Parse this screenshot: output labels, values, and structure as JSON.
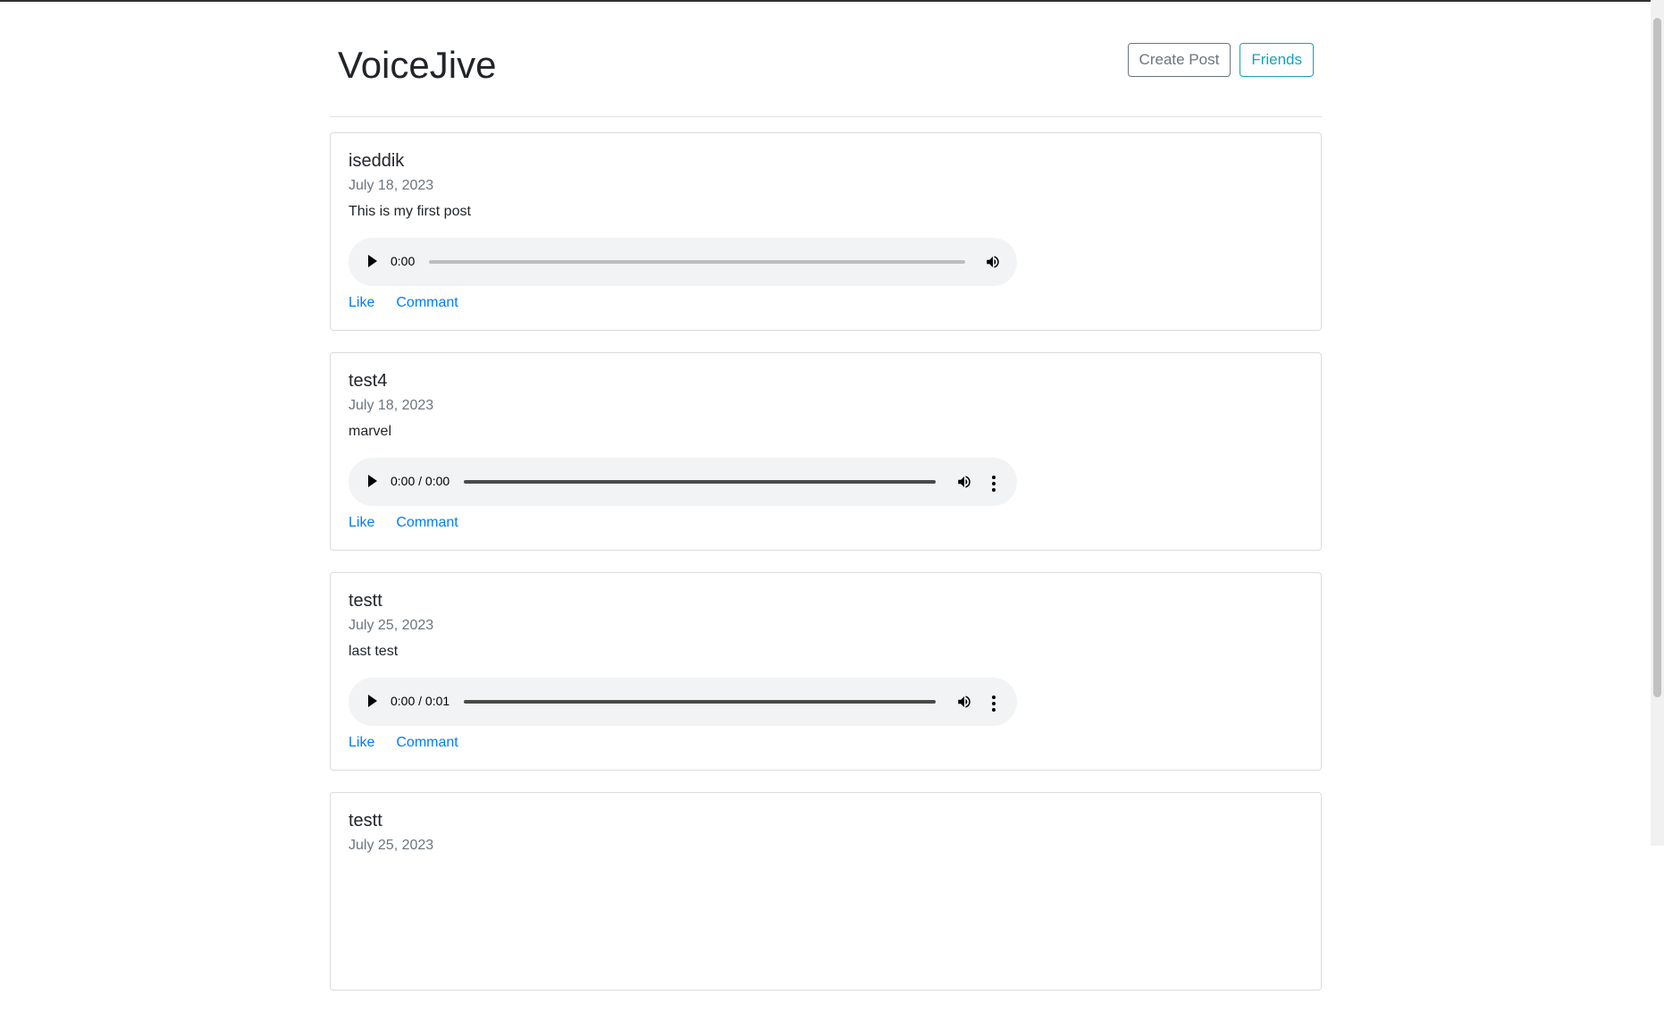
{
  "app": {
    "title": "VoiceJive"
  },
  "nav": {
    "create_post_label": "Create Post",
    "friends_label": "Friends"
  },
  "posts": [
    {
      "author": "iseddik",
      "date": "July 18, 2023",
      "text": "This is my first post",
      "audio_time": "0:00",
      "like_label": "Like",
      "comment_label": "Commant"
    },
    {
      "author": "test4",
      "date": "July 18, 2023",
      "text": "marvel",
      "audio_time": "0:00 / 0:00",
      "like_label": "Like",
      "comment_label": "Commant"
    },
    {
      "author": "testt",
      "date": "July 25, 2023",
      "text": "last test",
      "audio_time": "0:00 / 0:01",
      "like_label": "Like",
      "comment_label": "Commant"
    },
    {
      "author": "testt",
      "date": "July 25, 2023"
    }
  ]
}
